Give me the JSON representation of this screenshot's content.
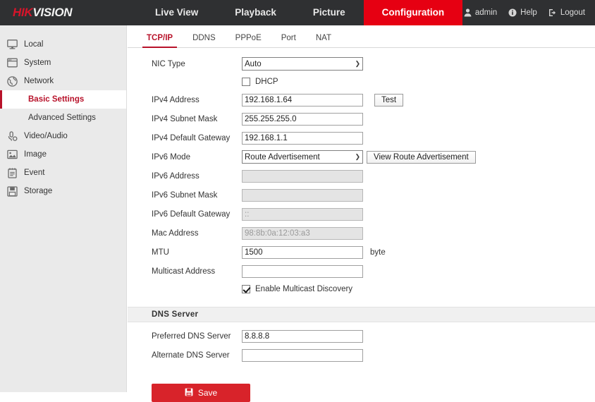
{
  "brand": {
    "part1": "HIK",
    "part2": "VISION"
  },
  "topnav": {
    "items": [
      {
        "label": "Live View",
        "active": false
      },
      {
        "label": "Playback",
        "active": false
      },
      {
        "label": "Picture",
        "active": false
      },
      {
        "label": "Configuration",
        "active": true
      }
    ],
    "user": {
      "name": "admin",
      "icon": "user-icon"
    },
    "help": {
      "label": "Help",
      "icon": "info-icon"
    },
    "logout": {
      "label": "Logout",
      "icon": "logout-icon"
    }
  },
  "sidebar": {
    "items": [
      {
        "label": "Local",
        "icon": "monitor-icon"
      },
      {
        "label": "System",
        "icon": "window-icon"
      },
      {
        "label": "Network",
        "icon": "globe-icon"
      }
    ],
    "sub": [
      {
        "label": "Basic Settings",
        "active": true
      },
      {
        "label": "Advanced Settings",
        "active": false
      }
    ],
    "items2": [
      {
        "label": "Video/Audio",
        "icon": "microphone-icon"
      },
      {
        "label": "Image",
        "icon": "picture-icon"
      },
      {
        "label": "Event",
        "icon": "clipboard-icon"
      },
      {
        "label": "Storage",
        "icon": "floppy-icon"
      }
    ]
  },
  "tabs": [
    {
      "label": "TCP/IP",
      "active": true
    },
    {
      "label": "DDNS",
      "active": false
    },
    {
      "label": "PPPoE",
      "active": false
    },
    {
      "label": "Port",
      "active": false
    },
    {
      "label": "NAT",
      "active": false
    }
  ],
  "form": {
    "nic_type": {
      "label": "NIC Type",
      "value": "Auto"
    },
    "dhcp": {
      "label": "DHCP",
      "checked": false
    },
    "ipv4_address": {
      "label": "IPv4 Address",
      "value": "192.168.1.64"
    },
    "test_button": "Test",
    "ipv4_subnet": {
      "label": "IPv4 Subnet Mask",
      "value": "255.255.255.0"
    },
    "ipv4_gateway": {
      "label": "IPv4 Default Gateway",
      "value": "192.168.1.1"
    },
    "ipv6_mode": {
      "label": "IPv6 Mode",
      "value": "Route Advertisement"
    },
    "view_route_button": "View Route Advertisement",
    "ipv6_address": {
      "label": "IPv6 Address",
      "value": ""
    },
    "ipv6_subnet": {
      "label": "IPv6 Subnet Mask",
      "value": ""
    },
    "ipv6_gateway": {
      "label": "IPv6 Default Gateway",
      "value": "::"
    },
    "mac_address": {
      "label": "Mac Address",
      "value": "98:8b:0a:12:03:a3"
    },
    "mtu": {
      "label": "MTU",
      "value": "1500",
      "unit": "byte"
    },
    "multicast_address": {
      "label": "Multicast Address",
      "value": ""
    },
    "multicast_discovery": {
      "label": "Enable Multicast Discovery",
      "checked": true
    },
    "dns_section_title": "DNS Server",
    "preferred_dns": {
      "label": "Preferred DNS Server",
      "value": "8.8.8.8"
    },
    "alternate_dns": {
      "label": "Alternate DNS Server",
      "value": ""
    },
    "save_button": {
      "label": "Save",
      "icon": "floppy-icon"
    }
  },
  "colors": {
    "brand_red": "#e60012",
    "accent_red": "#b8122a",
    "save_red": "#d8232a",
    "topbar_bg": "#2f3032",
    "sidebar_bg": "#eaeaea"
  }
}
